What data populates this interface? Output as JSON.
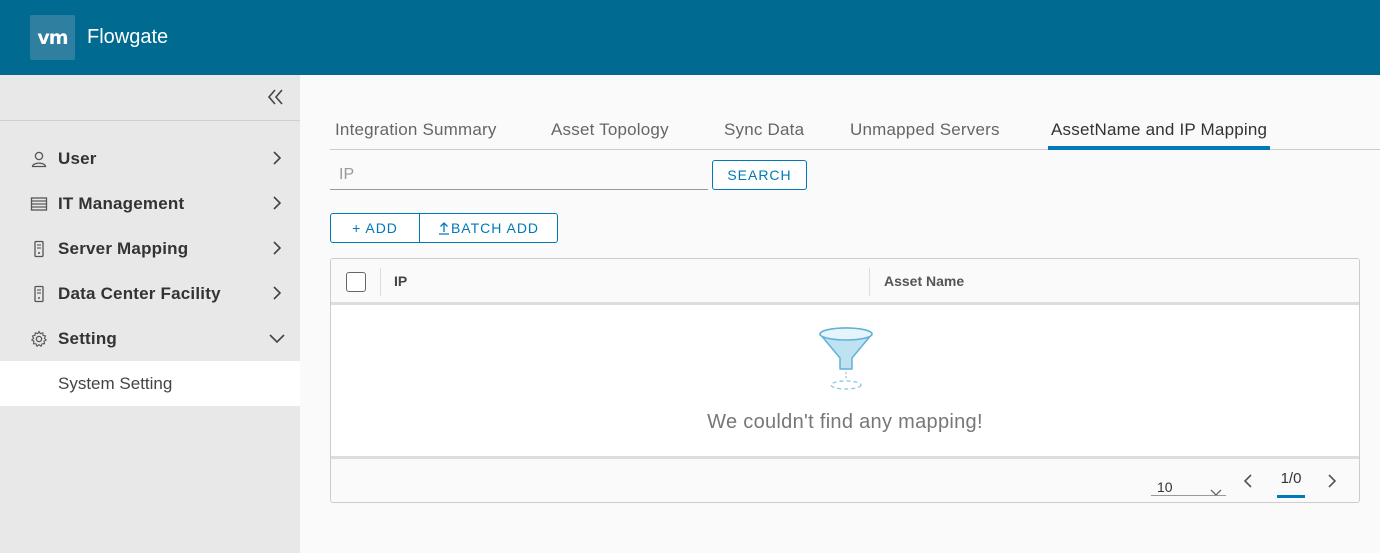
{
  "header": {
    "logo_text": "vm",
    "app_title": "Flowgate"
  },
  "sidebar": {
    "collapse_icon": "double-chevron-left-icon",
    "items": [
      {
        "label": "User",
        "icon": "user-icon",
        "chevron": "right"
      },
      {
        "label": "IT Management",
        "icon": "server-list-icon",
        "chevron": "right"
      },
      {
        "label": "Server Mapping",
        "icon": "device-icon",
        "chevron": "right"
      },
      {
        "label": "Data Center Facility",
        "icon": "device-icon",
        "chevron": "right"
      },
      {
        "label": "Setting",
        "icon": "gear-icon",
        "chevron": "down"
      }
    ],
    "sub_items": [
      {
        "label": "System Setting"
      }
    ]
  },
  "tabs": [
    {
      "label": "Integration Summary",
      "active": false
    },
    {
      "label": "Asset Topology",
      "active": false
    },
    {
      "label": "Sync Data",
      "active": false
    },
    {
      "label": "Unmapped Servers",
      "active": false
    },
    {
      "label": "AssetName and IP Mapping",
      "active": true
    }
  ],
  "search": {
    "placeholder": "IP",
    "value": "",
    "button_label": "SEARCH"
  },
  "actions": {
    "add_label": "+ ADD",
    "batch_add_label": "BATCH ADD"
  },
  "table": {
    "columns": [
      "IP",
      "Asset Name"
    ],
    "rows": [],
    "empty_message": "We couldn't find any mapping!",
    "footer": {
      "page_size": "10",
      "page_info": "1/0"
    }
  },
  "colors": {
    "header_bg": "#006a91",
    "accent": "#0079b8",
    "sidebar_bg": "#e8e8e8"
  }
}
